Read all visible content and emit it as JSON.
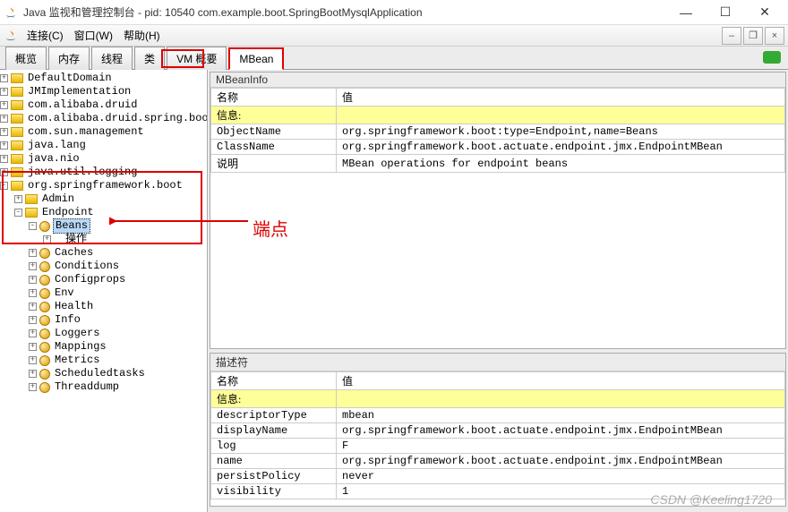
{
  "window": {
    "title": "Java 监视和管理控制台 - pid: 10540 com.example.boot.SpringBootMysqlApplication"
  },
  "menu": {
    "connect": "连接(C)",
    "window": "窗口(W)",
    "help": "帮助(H)"
  },
  "tabs": [
    "概览",
    "内存",
    "线程",
    "类",
    "VM 概要",
    "MBean"
  ],
  "tree": {
    "roots": [
      "DefaultDomain",
      "JMImplementation",
      "com.alibaba.druid",
      "com.alibaba.druid.spring.boot.a",
      "com.sun.management",
      "java.lang",
      "java.nio",
      "java.util.logging"
    ],
    "spring": "org.springframework.boot",
    "admin": "Admin",
    "endpoint": "Endpoint",
    "beans": "Beans",
    "ops": "操作",
    "children": [
      "Caches",
      "Conditions",
      "Configprops",
      "Env",
      "Health",
      "Info",
      "Loggers",
      "Mappings",
      "Metrics",
      "Scheduledtasks",
      "Threaddump"
    ]
  },
  "annotation": "端点",
  "mbeaninfo": {
    "title": "MBeanInfo",
    "header_name": "名称",
    "header_value": "值",
    "section": "信息:",
    "rows": [
      [
        "ObjectName",
        "org.springframework.boot:type=Endpoint,name=Beans"
      ],
      [
        "ClassName",
        "org.springframework.boot.actuate.endpoint.jmx.EndpointMBean"
      ],
      [
        "说明",
        "MBean operations for endpoint beans"
      ]
    ]
  },
  "descriptor": {
    "title": "描述符",
    "header_name": "名称",
    "header_value": "值",
    "section": "信息:",
    "rows": [
      [
        "descriptorType",
        "mbean"
      ],
      [
        "displayName",
        "org.springframework.boot.actuate.endpoint.jmx.EndpointMBean"
      ],
      [
        "log",
        "F"
      ],
      [
        "name",
        "org.springframework.boot.actuate.endpoint.jmx.EndpointMBean"
      ],
      [
        "persistPolicy",
        "never"
      ],
      [
        "visibility",
        "1"
      ]
    ]
  },
  "watermark": "CSDN @Keeling1720"
}
